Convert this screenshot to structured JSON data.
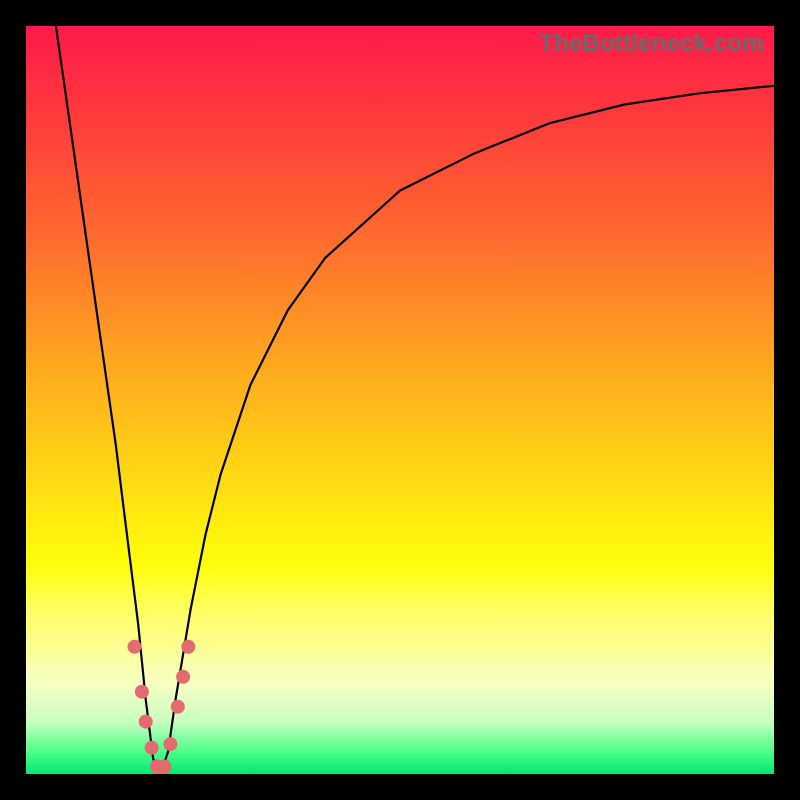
{
  "watermark": "TheBottleneck.com",
  "chart_data": {
    "type": "line",
    "title": "",
    "xlabel": "",
    "ylabel": "",
    "xlim": [
      0,
      100
    ],
    "ylim": [
      0,
      100
    ],
    "series": [
      {
        "name": "bottleneck-curve",
        "x": [
          4.0,
          6.0,
          8.0,
          10.0,
          12.0,
          13.0,
          14.0,
          15.0,
          16.0,
          17.0,
          18.0,
          19.0,
          20.0,
          22.0,
          24.0,
          26.0,
          30.0,
          35.0,
          40.0,
          50.0,
          60.0,
          70.0,
          80.0,
          90.0,
          100.0
        ],
        "values": [
          100,
          86.0,
          72.0,
          58.0,
          44.0,
          36.0,
          28.0,
          20.0,
          10.0,
          2.0,
          0.0,
          3.0,
          10.0,
          22.0,
          32.0,
          40.0,
          52.0,
          62.0,
          69.0,
          78.0,
          83.0,
          87.0,
          89.5,
          91.0,
          92.0
        ]
      }
    ],
    "markers": {
      "name": "highlight-dots",
      "x": [
        14.5,
        15.5,
        16.0,
        16.8,
        17.5,
        18.0,
        18.5,
        19.3,
        20.3,
        21.0,
        21.7
      ],
      "values": [
        17.0,
        11.0,
        7.0,
        3.5,
        1.0,
        0.0,
        1.0,
        4.0,
        9.0,
        13.0,
        17.0
      ]
    },
    "gradient_meaning": "vertical color = bottleneck severity (red high, green low)"
  }
}
